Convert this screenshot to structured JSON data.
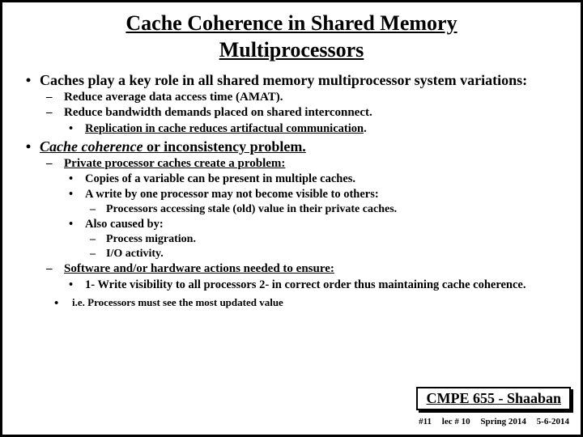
{
  "title_l1": "Cache Coherence in Shared Memory",
  "title_l2": "Multiprocessors",
  "b1": "Caches play a key role in all shared memory multiprocessor system variations:",
  "b1_1": "Reduce average data access time (AMAT).",
  "b1_2": "Reduce bandwidth demands placed on shared interconnect.",
  "b1_2_1": "Replication in cache reduces artifactual communication",
  "b2_a": "Cache coherence",
  "b2_b": " or inconsistency problem.",
  "b2_1": "Private processor caches create a problem:",
  "b2_1_1": "Copies of a variable can be present in multiple caches.",
  "b2_1_2": "A write by one processor may not become visible to others:",
  "b2_1_2_1": "Processors accessing stale (old) value in their private caches.",
  "b2_1_3": "Also caused by:",
  "b2_1_3_1": "Process migration.",
  "b2_1_3_2": "I/O activity.",
  "b2_2": "Software and/or hardware actions needed to ensure:",
  "b2_2_1": "1- Write visibility to all processors  2- in correct order thus maintaining cache coherence.",
  "b2_3": "i.e. Processors must see the most updated value",
  "footer_course": "CMPE 655 - Shaaban",
  "footer_page": "#11",
  "footer_lec": "lec # 10",
  "footer_term": "Spring 2014",
  "footer_date": "5-6-2014"
}
